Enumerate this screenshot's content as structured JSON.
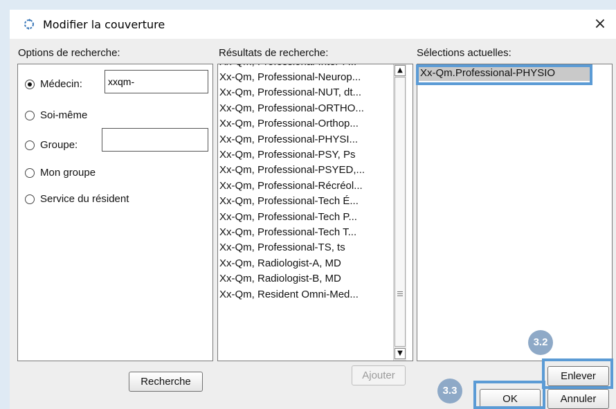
{
  "window": {
    "title": "Modifier la couverture",
    "close_glyph": "×",
    "icon": "refresh-gear-icon"
  },
  "options": {
    "label": "Options de recherche:",
    "radio_medecin": "Médecin:",
    "medecin_value": "xxqm-",
    "radio_soi_meme": "Soi-même",
    "radio_groupe": "Groupe:",
    "groupe_value": "",
    "radio_mon_groupe": "Mon groupe",
    "radio_service": "Service du résident",
    "selected": "Médecin"
  },
  "results": {
    "label": "Résultats de recherche:",
    "partial_item": "Xx-Qm, Professional-Inter-P...",
    "items": [
      "Xx-Qm, Professional-Neurop...",
      "Xx-Qm, Professional-NUT, dt...",
      "Xx-Qm, Professional-ORTHO...",
      "Xx-Qm, Professional-Orthop...",
      "Xx-Qm, Professional-PHYSI...",
      "Xx-Qm, Professional-PSY, Ps",
      "Xx-Qm, Professional-PSYED,...",
      "Xx-Qm, Professional-Récréol...",
      "Xx-Qm, Professional-Tech É...",
      "Xx-Qm, Professional-Tech P...",
      "Xx-Qm, Professional-Tech T...",
      "Xx-Qm, Professional-TS, ts",
      "Xx-Qm, Radiologist-A, MD",
      "Xx-Qm, Radiologist-B, MD",
      "Xx-Qm, Resident Omni-Med..."
    ]
  },
  "selections": {
    "label": "Sélections actuelles:",
    "items": [
      "Xx-Qm.Professional-PHYSIO"
    ]
  },
  "buttons": {
    "recherche": "Recherche",
    "ajouter": "Ajouter",
    "enlever": "Enlever",
    "ok": "OK",
    "annuler": "Annuler"
  },
  "annotations": {
    "step_enlever": "3.2",
    "step_ok": "3.3",
    "highlight_color": "#5b9bd5",
    "badge_color": "#8ea9c7"
  },
  "scrollbar": {
    "up_glyph": "▲",
    "down_glyph": "▼"
  }
}
